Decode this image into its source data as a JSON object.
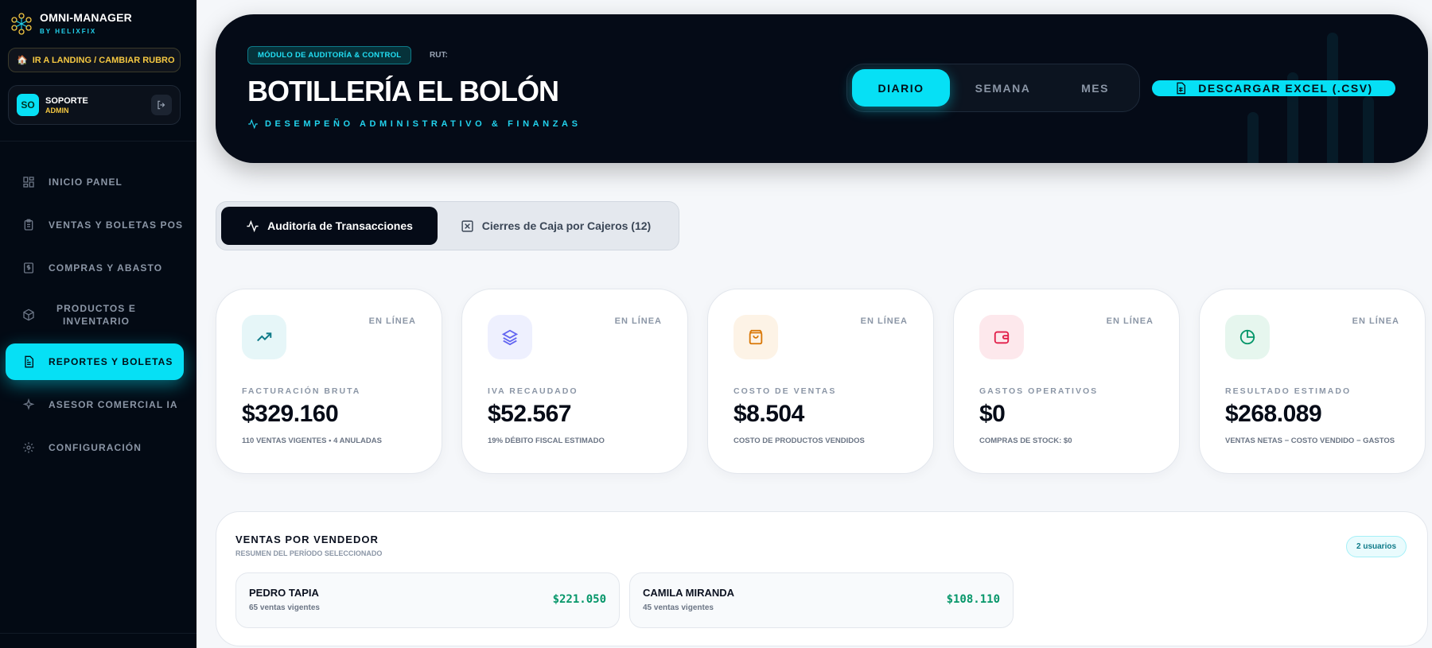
{
  "brand": {
    "name": "OMNI-MANAGER",
    "sub": "BY HELIXFIX"
  },
  "sidebar": {
    "landing_button": "IR A LANDING / CAMBIAR RUBRO",
    "user": {
      "initials": "SO",
      "name": "SOPORTE",
      "role": "ADMIN"
    },
    "items": [
      {
        "label": "INICIO PANEL",
        "icon": "grid-icon"
      },
      {
        "label": "VENTAS Y BOLETAS POS",
        "icon": "clipboard-icon"
      },
      {
        "label": "COMPRAS Y ABASTO",
        "icon": "dollar-doc-icon"
      },
      {
        "label": "PRODUCTOS E INVENTARIO",
        "icon": "box-icon"
      },
      {
        "label": "REPORTES Y BOLETAS",
        "icon": "report-icon",
        "active": true
      },
      {
        "label": "ASESOR COMERCIAL IA",
        "icon": "sparkle-icon"
      },
      {
        "label": "CONFIGURACIÓN",
        "icon": "gear-icon"
      }
    ]
  },
  "header": {
    "module_badge": "MÓDULO DE AUDITORÍA & CONTROL",
    "rut": "RUT:",
    "business_name": "BOTILLERÍA EL BOLÓN",
    "subtitle": "DESEMPEÑO ADMINISTRATIVO & FINANZAS",
    "periods": [
      "DIARIO",
      "SEMANA",
      "MES"
    ],
    "active_period": "DIARIO",
    "export_label": "DESCARGAR EXCEL (.CSV)"
  },
  "tabs": [
    {
      "label": "Auditoría de Transacciones",
      "icon": "activity-icon",
      "active": true
    },
    {
      "label": "Cierres de Caja por Cajeros (12)",
      "icon": "close-box-icon",
      "active": false
    }
  ],
  "cards": [
    {
      "label": "FACTURACIÓN BRUTA",
      "value": "$329.160",
      "sub": "110 VENTAS VIGENTES • 4 ANULADAS",
      "status": "EN LÍNEA",
      "icon": "trending-up-icon",
      "color": "#0e7a88",
      "bg": "#e6f6f8"
    },
    {
      "label": "IVA RECAUDADO",
      "value": "$52.567",
      "sub": "19% DÉBITO FISCAL ESTIMADO",
      "status": "EN LÍNEA",
      "icon": "layers-icon",
      "color": "#6366f1",
      "bg": "#eef0fe"
    },
    {
      "label": "COSTO DE VENTAS",
      "value": "$8.504",
      "sub": "COSTO DE PRODUCTOS VENDIDOS",
      "status": "EN LÍNEA",
      "icon": "bag-icon",
      "color": "#d97706",
      "bg": "#fdf3e6"
    },
    {
      "label": "GASTOS OPERATIVOS",
      "value": "$0",
      "sub": "COMPRAS DE STOCK: $0",
      "status": "EN LÍNEA",
      "icon": "wallet-icon",
      "color": "#e11d48",
      "bg": "#fde8ec"
    },
    {
      "label": "RESULTADO ESTIMADO",
      "value": "$268.089",
      "sub": "VENTAS NETAS − COSTO VENDIDO − GASTOS",
      "status": "EN LÍNEA",
      "icon": "pie-icon",
      "color": "#059669",
      "bg": "#e6f6ee"
    }
  ],
  "vendors": {
    "title": "VENTAS POR VENDEDOR",
    "subtitle": "RESUMEN DEL PERÍODO SELECCIONADO",
    "badge": "2 usuarios",
    "rows": [
      {
        "name": "PEDRO TAPIA",
        "sales": "65 ventas vigentes",
        "amount": "$221.050"
      },
      {
        "name": "CAMILA MIRANDA",
        "sales": "45 ventas vigentes",
        "amount": "$108.110"
      }
    ]
  },
  "colors": {
    "accent": "#06e0f5",
    "dark": "#050b17",
    "sidebar": "#030a14",
    "gold": "#f5c842",
    "green": "#059669"
  }
}
